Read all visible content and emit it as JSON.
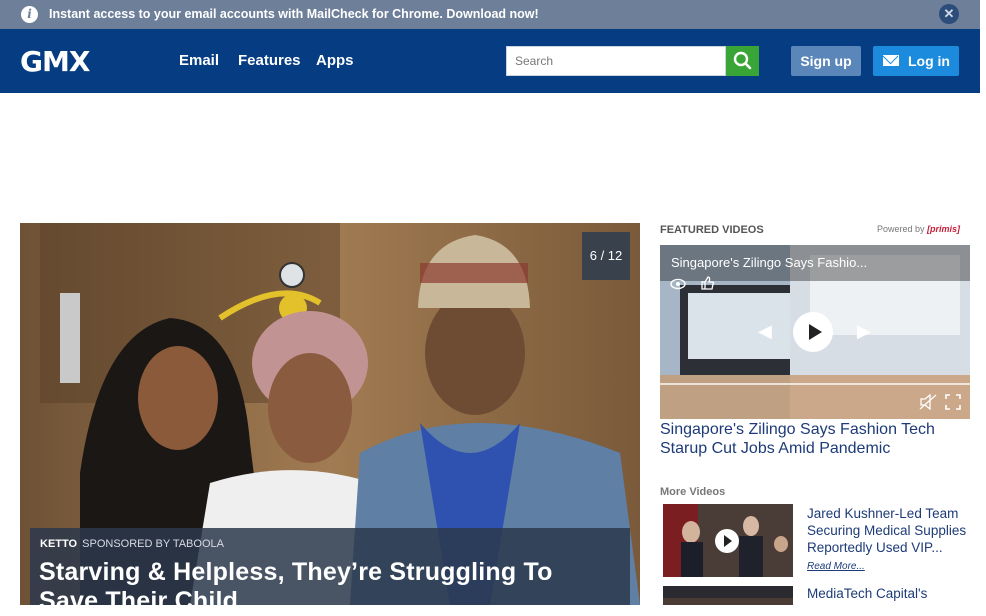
{
  "banner": {
    "text": "Instant access to your email accounts with MailCheck for Chrome. Download now!",
    "info_icon": "i",
    "close_icon": "✕"
  },
  "header": {
    "logo": "GMX",
    "nav": [
      "Email",
      "Features",
      "Apps"
    ],
    "search_placeholder": "Search",
    "signup_label": "Sign up",
    "login_label": "Log in"
  },
  "hero": {
    "counter": "6 / 12",
    "source": "KETTO",
    "sponsored": "SPONSORED BY TABOOLA",
    "title": "Starving & Helpless, They’re Struggling To Save Their Child"
  },
  "featured": {
    "label": "FEATURED VIDEOS",
    "powered_prefix": "Powered by",
    "powered_brand": "[primis]",
    "video_title": "Singapore's Zilingo Says Fashio...",
    "headline": "Singapore's Zilingo Says Fashion Tech Starup Cut Jobs Amid Pandemic"
  },
  "more": {
    "label": "More Videos",
    "items": [
      {
        "title": "Jared Kushner-Led Team Securing Medical Supplies Reportedly Used VIP...",
        "read_more": "Read More..."
      },
      {
        "title": "MediaTech Capital's"
      }
    ]
  },
  "colors": {
    "header": "#063c82",
    "banner": "#6e7f99",
    "search_button": "#3aa537",
    "login": "#1c8bdd",
    "signup": "#5a86b9"
  }
}
